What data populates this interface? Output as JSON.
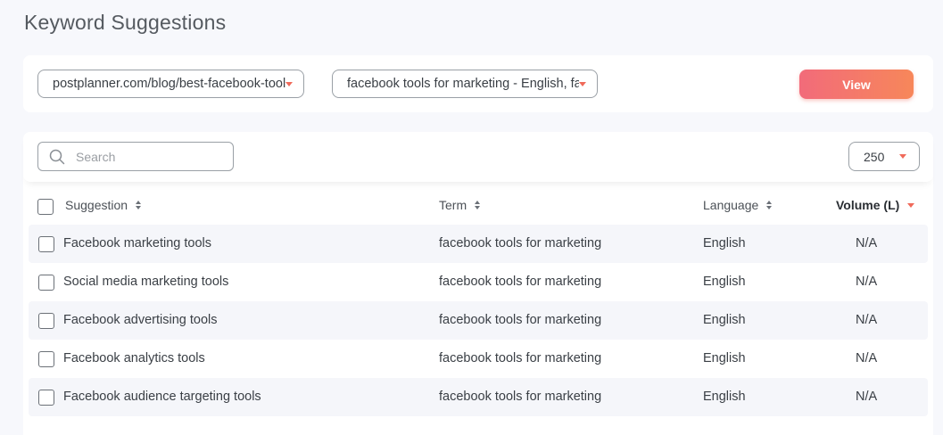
{
  "page": {
    "title": "Keyword Suggestions"
  },
  "filters": {
    "url_value": "postplanner.com/blog/best-facebook-tools",
    "term_value": "facebook tools for marketing - English, facebook",
    "view_label": "View",
    "caret_icon": "chevron-down-icon"
  },
  "toolbar": {
    "search_placeholder": "Search",
    "per_page": "250"
  },
  "table": {
    "headers": {
      "suggestion": "Suggestion",
      "term": "Term",
      "language": "Language",
      "volume": "Volume (L)"
    },
    "sorted_column": "volume",
    "rows": [
      {
        "suggestion": "Facebook marketing tools",
        "term": "facebook tools for marketing",
        "language": "English",
        "volume": "N/A"
      },
      {
        "suggestion": "Social media marketing tools",
        "term": "facebook tools for marketing",
        "language": "English",
        "volume": "N/A"
      },
      {
        "suggestion": "Facebook advertising tools",
        "term": "facebook tools for marketing",
        "language": "English",
        "volume": "N/A"
      },
      {
        "suggestion": "Facebook analytics tools",
        "term": "facebook tools for marketing",
        "language": "English",
        "volume": "N/A"
      },
      {
        "suggestion": "Facebook audience targeting tools",
        "term": "facebook tools for marketing",
        "language": "English",
        "volume": "N/A"
      }
    ]
  },
  "colors": {
    "accent": "#f06a5a",
    "button_gradient_start": "#f26b7a",
    "button_gradient_end": "#f7875a",
    "background": "#f7f8fc",
    "row_stripe": "#f5f6fa"
  }
}
